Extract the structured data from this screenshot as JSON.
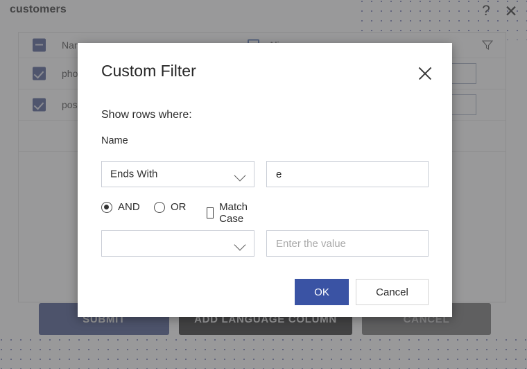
{
  "window": {
    "title": "customers",
    "help_icon": "question-mark-icon",
    "close_icon": "close-icon"
  },
  "table": {
    "columns": [
      "Name",
      "Alias"
    ],
    "rows": [
      {
        "checkbox": "indeterminate",
        "name": "Name",
        "alias": "Alias",
        "is_header": true
      },
      {
        "checkbox": "checked",
        "name": "pho",
        "alias": ""
      },
      {
        "checkbox": "checked",
        "name": "pos",
        "alias": ""
      }
    ],
    "filter_icon": "funnel-filter-icon"
  },
  "footer": {
    "submit_label": "SUBMIT",
    "add_language_label": "ADD LANGUAGE COLUMN",
    "cancel_label": "CANCEL"
  },
  "dialog": {
    "title": "Custom Filter",
    "close_icon": "close-icon",
    "show_rows_label": "Show rows where:",
    "field_label": "Name",
    "condition_1": {
      "operator": "Ends With",
      "value": "e"
    },
    "logic": {
      "and_label": "AND",
      "or_label": "OR",
      "selected": "AND",
      "match_case_label": "Match Case",
      "match_case_checked": false
    },
    "condition_2": {
      "operator": "",
      "value": "",
      "value_placeholder": "Enter the value"
    },
    "ok_label": "OK",
    "cancel_label": "Cancel"
  },
  "colors": {
    "primary_blue": "#3a53a4",
    "footer_submit": "#374884",
    "footer_add_language": "#1b1b1b",
    "footer_cancel": "#666666",
    "checkbox_blue": "#3d4e88",
    "overlay": "rgba(90,90,92,0.62)",
    "dot_pattern": "#6a72b4"
  }
}
